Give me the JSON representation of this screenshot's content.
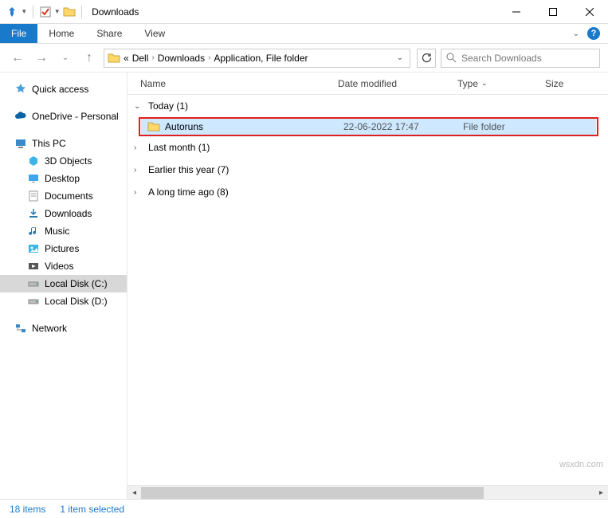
{
  "title": "Downloads",
  "ribbon": {
    "file": "File",
    "home": "Home",
    "share": "Share",
    "view": "View"
  },
  "breadcrumb": {
    "lead": "«",
    "p1": "Dell",
    "p2": "Downloads",
    "p3": "Application, File folder"
  },
  "search": {
    "placeholder": "Search Downloads"
  },
  "sidebar": {
    "quick": "Quick access",
    "onedrive": "OneDrive - Personal",
    "thispc": "This PC",
    "objects3d": "3D Objects",
    "desktop": "Desktop",
    "documents": "Documents",
    "downloads": "Downloads",
    "music": "Music",
    "pictures": "Pictures",
    "videos": "Videos",
    "diskc": "Local Disk (C:)",
    "diskd": "Local Disk (D:)",
    "network": "Network"
  },
  "columns": {
    "name": "Name",
    "date": "Date modified",
    "type": "Type",
    "size": "Size"
  },
  "groups": {
    "today": "Today (1)",
    "lastmonth": "Last month (1)",
    "earlier": "Earlier this year (7)",
    "longtime": "A long time ago (8)"
  },
  "item": {
    "name": "Autoruns",
    "date": "22-06-2022 17:47",
    "type": "File folder"
  },
  "status": {
    "count": "18 items",
    "selected": "1 item selected"
  },
  "watermark": "wsxdn.com"
}
